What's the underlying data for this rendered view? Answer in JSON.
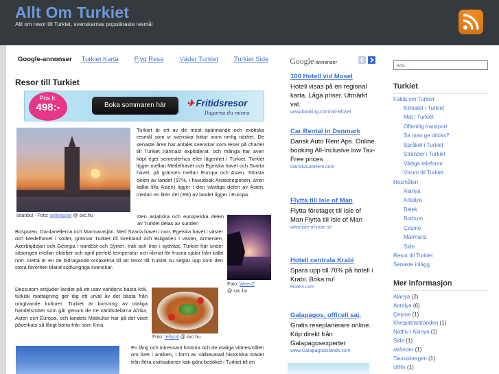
{
  "header": {
    "title": "Allt Om Turkiet",
    "tagline": "Allt om resor till Turkiet, svenskarnas populäraste resmål",
    "rss_icon": "rss-icon",
    "accent_color": "#6f98dd",
    "rss_color": "#ef8a22"
  },
  "top_ads": {
    "label": "Google-annonser",
    "links": [
      "Turkiet Karta",
      "Flyg Resa",
      "Väder Turkiet",
      "Turkiet Side"
    ]
  },
  "article": {
    "heading": "Resor till Turkiet",
    "banner": {
      "price_prefix": "Pris fr.",
      "price": "498:-",
      "button": "Boka sommaren här",
      "logo": "Fritidsresor",
      "slogan": "Dagarna du minns"
    },
    "photos": [
      {
        "caption_prefix": "Istanbul - Foto: ",
        "caption_link": "selimguler",
        "caption_suffix": " @ sxc.hu"
      },
      {
        "caption_prefix": "Foto: ",
        "caption_link": "WoesZ",
        "caption_suffix": "@ sxc.hu"
      },
      {
        "caption_prefix": "Foto: ",
        "caption_link": "tellgraf",
        "caption_suffix": " @ sxc.hu"
      }
    ],
    "p1": "Turkiet är ett av de mest spännande och exotiska resmål som vi svenskar hittar inom rimlig närhet. De senaste åren har antalet svenskar som reser på charter till Turkiet närmast exploderat, och många har även köpt eget semesterhus eller lägenhet i Turkiet. Turkiet ligger mellan Medelhavet och Egeiska havet och Svarta havet, på gränsen mellan Europa och Asien. Största delen av landet (97%, i huvudsak Anatolregionen, även kallat lilla Asien) ligger i den västliga delen av Asien, medan en liten del (3%) av landet ligger i Europa.",
    "p2_top": "Den asiatiska och europeiska delen av Turkiet delas av sunden",
    "p2": "Bosporen, Dardanellerna och Marmarasjön. Med Svarta havet i norr, Egeiska havet i väster och Medelhavet i söder, gränsar Turkiet till Grekland och Bulgarien i väster, Armenien, Azerbajdzjan och Georgia i nordöst och Syrien, Irak och Iran i sydväst. Turkiet har under säsongen mellan oktober och april perfekt temperatur och klimat för frusna själar från kalla norr. Detta är en de bidragande orsakerna till att resor till Turkiet nu seglar upp som den stora favoriten bland solhungriga svenskar.",
    "p3": "Dessutom erbjuder landet på ett utav världens bästa kök, turkisk mattagning ger dig ett urval av det bästa från omgivande kulturer. Turkiet är korsning av otaliga handelsrutter som går genom de tre världsdelarna Afrika, Asien och Europa, och landets Matkultur har på det viset påverkats så långt borta från som Kina.",
    "p4": "En lång och intressant historia och de otaliga vittnesmålen om livet i antiken, i form av välbevarad historiska städer från flera civilisationer kan göra besöket i Turkiet till en"
  },
  "ads": {
    "header_logo": "Google",
    "header_label": "-annonser",
    "prev_icon": "chevron-left-icon",
    "next_icon": "chevron-right-icon",
    "items": [
      {
        "title": "100 Hotell vid Mosel",
        "body": "Hotell visas på en regional karta. Låga priser. Utmärkt val.",
        "url": "www.booking.com/vid-Mosel"
      },
      {
        "title": "Car Rental in Denmark",
        "body": "Dansk Auto Rent Aps. Online booking All-Inclusive low Tax-Free prices",
        "url": "DanskAutoRent.com"
      },
      {
        "title": "Flytta till Isle of Man",
        "body": "Flytta företaget till Isle of Man Flytta till Isle of Man",
        "url": "www.isle-of-man.se"
      },
      {
        "title": "Hotell centrala Krabi",
        "body": "Spara upp till 70% på hotell i Krabi. Boka nu!",
        "url": "Hotels.com"
      },
      {
        "title": "Galapagos, officell saj.",
        "body": "Gratis reseplanerare online. Köp direkt från Galapagosexperter",
        "url": "www.Galapagosislands.com"
      }
    ]
  },
  "sidebar": {
    "search_placeholder": "Sök...",
    "turkiet_heading": "Turkiet",
    "turkiet_items": [
      "Fakta om Turkiet",
      "Klimatet i Turkiet",
      "Mat i Turkiet",
      "Offentlig transport",
      "Sa man ge dricks?",
      "Språket i Turkiet",
      "Stränder i Turkiet",
      "Viktiga telefonnr.",
      "Visum till Turkiet",
      "Resmålen",
      "Alanya",
      "Antalya",
      "Belek",
      "Bodrum",
      "Çeşme",
      "Marmaris",
      "Side",
      "Resor till Turkiet",
      "Senaste inlägg"
    ],
    "more_heading": "Mer informasjon",
    "more_items": [
      {
        "label": "Alanya",
        "count": " (2)"
      },
      {
        "label": "Antalya",
        "count": " (6)"
      },
      {
        "label": "Çeşme",
        "count": " (1)"
      },
      {
        "label": "Kleopatrastranden",
        "count": " (1)"
      },
      {
        "label": "Nattliv i Alanya",
        "count": " (1)"
      },
      {
        "label": "Side",
        "count": " (1)"
      },
      {
        "label": "stränder",
        "count": " (1)"
      },
      {
        "label": "Taurusbergen",
        "count": " (1)"
      },
      {
        "label": "Utfilv",
        "count": " (1)"
      }
    ]
  }
}
